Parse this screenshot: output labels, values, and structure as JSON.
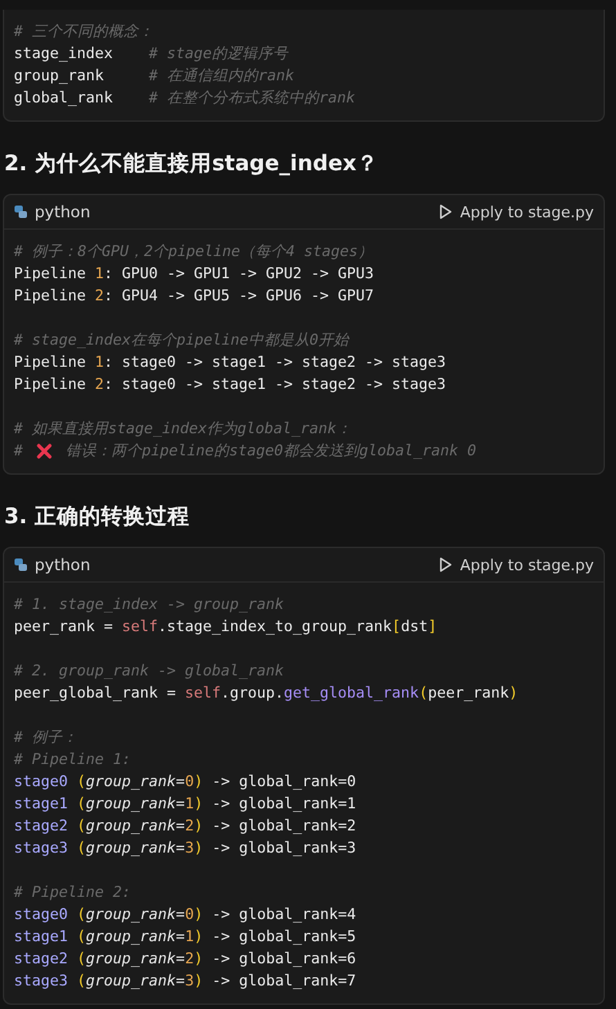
{
  "blocks": [
    {
      "kind": "code",
      "groups": [
        [
          [
            {
              "text": "# 三个不同的概念：",
              "kind": "comment"
            }
          ],
          [
            {
              "text": "stage_index    ",
              "kind": "plain"
            },
            {
              "text": "# stage的逻辑序号",
              "kind": "comment"
            }
          ],
          [
            {
              "text": "group_rank     ",
              "kind": "plain"
            },
            {
              "text": "# 在通信组内的rank",
              "kind": "comment"
            }
          ],
          [
            {
              "text": "global_rank    ",
              "kind": "plain"
            },
            {
              "text": "# 在整个分布式系统中的rank",
              "kind": "comment"
            }
          ]
        ]
      ]
    },
    {
      "kind": "heading",
      "text": "2. 为什么不能直接用stage_index？"
    },
    {
      "kind": "code",
      "header": {
        "language": "python",
        "action": "Apply to stage.py"
      },
      "groups": [
        [
          [
            {
              "text": "# 例子：8个GPU，2个pipeline（每个4 stages）",
              "kind": "comment"
            }
          ],
          [
            {
              "text": "Pipeline ",
              "kind": "plain"
            },
            {
              "text": "1",
              "kind": "number"
            },
            {
              "text": ": GPU0 -> GPU1 -> GPU2 -> GPU3",
              "kind": "plain"
            }
          ],
          [
            {
              "text": "Pipeline ",
              "kind": "plain"
            },
            {
              "text": "2",
              "kind": "number"
            },
            {
              "text": ": GPU4 -> GPU5 -> GPU6 -> GPU7",
              "kind": "plain"
            }
          ]
        ],
        [
          [
            {
              "text": "# stage_index在每个pipeline中都是从0开始",
              "kind": "comment"
            }
          ],
          [
            {
              "text": "Pipeline ",
              "kind": "plain"
            },
            {
              "text": "1",
              "kind": "number"
            },
            {
              "text": ": stage0 -> stage1 -> stage2 -> stage3",
              "kind": "plain"
            }
          ],
          [
            {
              "text": "Pipeline ",
              "kind": "plain"
            },
            {
              "text": "2",
              "kind": "number"
            },
            {
              "text": ": stage0 -> stage1 -> stage2 -> stage3",
              "kind": "plain"
            }
          ]
        ],
        [
          [
            {
              "text": "# 如果直接用stage_index作为global_rank：",
              "kind": "comment"
            }
          ],
          [
            {
              "text": "# ",
              "kind": "comment"
            },
            {
              "kind": "cross"
            },
            {
              "text": " 错误：两个pipeline的stage0都会发送到global_rank 0",
              "kind": "comment"
            }
          ]
        ]
      ]
    },
    {
      "kind": "heading",
      "text": "3. 正确的转换过程"
    },
    {
      "kind": "code",
      "header": {
        "language": "python",
        "action": "Apply to stage.py"
      },
      "groups": [
        [
          [
            {
              "text": "# 1. stage_index -> group_rank",
              "kind": "comment"
            }
          ],
          [
            {
              "text": "peer_rank = ",
              "kind": "plain"
            },
            {
              "text": "self",
              "kind": "self"
            },
            {
              "text": ".stage_index_to_group_rank",
              "kind": "plain"
            },
            {
              "text": "[",
              "kind": "bracket"
            },
            {
              "text": "dst",
              "kind": "plain"
            },
            {
              "text": "]",
              "kind": "bracket"
            }
          ]
        ],
        [
          [
            {
              "text": "# 2. group_rank -> global_rank",
              "kind": "comment"
            }
          ],
          [
            {
              "text": "peer_global_rank = ",
              "kind": "plain"
            },
            {
              "text": "self",
              "kind": "self"
            },
            {
              "text": ".group.",
              "kind": "plain"
            },
            {
              "text": "get_global_rank",
              "kind": "func"
            },
            {
              "text": "(",
              "kind": "bracket"
            },
            {
              "text": "peer_rank",
              "kind": "plain"
            },
            {
              "text": ")",
              "kind": "bracket"
            }
          ]
        ],
        [
          [
            {
              "text": "# 例子：",
              "kind": "comment"
            }
          ],
          [
            {
              "text": "# Pipeline 1:",
              "kind": "comment"
            }
          ],
          [
            {
              "text": "stage0 ",
              "kind": "var"
            },
            {
              "text": "(",
              "kind": "bracket"
            },
            {
              "text": "group_rank",
              "kind": "param"
            },
            {
              "text": "=",
              "kind": "plain"
            },
            {
              "text": "0",
              "kind": "number"
            },
            {
              "text": ")",
              "kind": "bracket"
            },
            {
              "text": " -> global_rank=0",
              "kind": "plain"
            }
          ],
          [
            {
              "text": "stage1 ",
              "kind": "var"
            },
            {
              "text": "(",
              "kind": "bracket"
            },
            {
              "text": "group_rank",
              "kind": "param"
            },
            {
              "text": "=",
              "kind": "plain"
            },
            {
              "text": "1",
              "kind": "number"
            },
            {
              "text": ")",
              "kind": "bracket"
            },
            {
              "text": " -> global_rank=1",
              "kind": "plain"
            }
          ],
          [
            {
              "text": "stage2 ",
              "kind": "var"
            },
            {
              "text": "(",
              "kind": "bracket"
            },
            {
              "text": "group_rank",
              "kind": "param"
            },
            {
              "text": "=",
              "kind": "plain"
            },
            {
              "text": "2",
              "kind": "number"
            },
            {
              "text": ")",
              "kind": "bracket"
            },
            {
              "text": " -> global_rank=2",
              "kind": "plain"
            }
          ],
          [
            {
              "text": "stage3 ",
              "kind": "var"
            },
            {
              "text": "(",
              "kind": "bracket"
            },
            {
              "text": "group_rank",
              "kind": "param"
            },
            {
              "text": "=",
              "kind": "plain"
            },
            {
              "text": "3",
              "kind": "number"
            },
            {
              "text": ")",
              "kind": "bracket"
            },
            {
              "text": " -> global_rank=3",
              "kind": "plain"
            }
          ]
        ],
        [
          [
            {
              "text": "# Pipeline 2:",
              "kind": "comment"
            }
          ],
          [
            {
              "text": "stage0 ",
              "kind": "var"
            },
            {
              "text": "(",
              "kind": "bracket"
            },
            {
              "text": "group_rank",
              "kind": "param"
            },
            {
              "text": "=",
              "kind": "plain"
            },
            {
              "text": "0",
              "kind": "number"
            },
            {
              "text": ")",
              "kind": "bracket"
            },
            {
              "text": " -> global_rank=4",
              "kind": "plain"
            }
          ],
          [
            {
              "text": "stage1 ",
              "kind": "var"
            },
            {
              "text": "(",
              "kind": "bracket"
            },
            {
              "text": "group_rank",
              "kind": "param"
            },
            {
              "text": "=",
              "kind": "plain"
            },
            {
              "text": "1",
              "kind": "number"
            },
            {
              "text": ")",
              "kind": "bracket"
            },
            {
              "text": " -> global_rank=5",
              "kind": "plain"
            }
          ],
          [
            {
              "text": "stage2 ",
              "kind": "var"
            },
            {
              "text": "(",
              "kind": "bracket"
            },
            {
              "text": "group_rank",
              "kind": "param"
            },
            {
              "text": "=",
              "kind": "plain"
            },
            {
              "text": "2",
              "kind": "number"
            },
            {
              "text": ")",
              "kind": "bracket"
            },
            {
              "text": " -> global_rank=6",
              "kind": "plain"
            }
          ],
          [
            {
              "text": "stage3 ",
              "kind": "var"
            },
            {
              "text": "(",
              "kind": "bracket"
            },
            {
              "text": "group_rank",
              "kind": "param"
            },
            {
              "text": "=",
              "kind": "plain"
            },
            {
              "text": "3",
              "kind": "number"
            },
            {
              "text": ")",
              "kind": "bracket"
            },
            {
              "text": " -> global_rank=7",
              "kind": "plain"
            }
          ]
        ]
      ]
    }
  ]
}
